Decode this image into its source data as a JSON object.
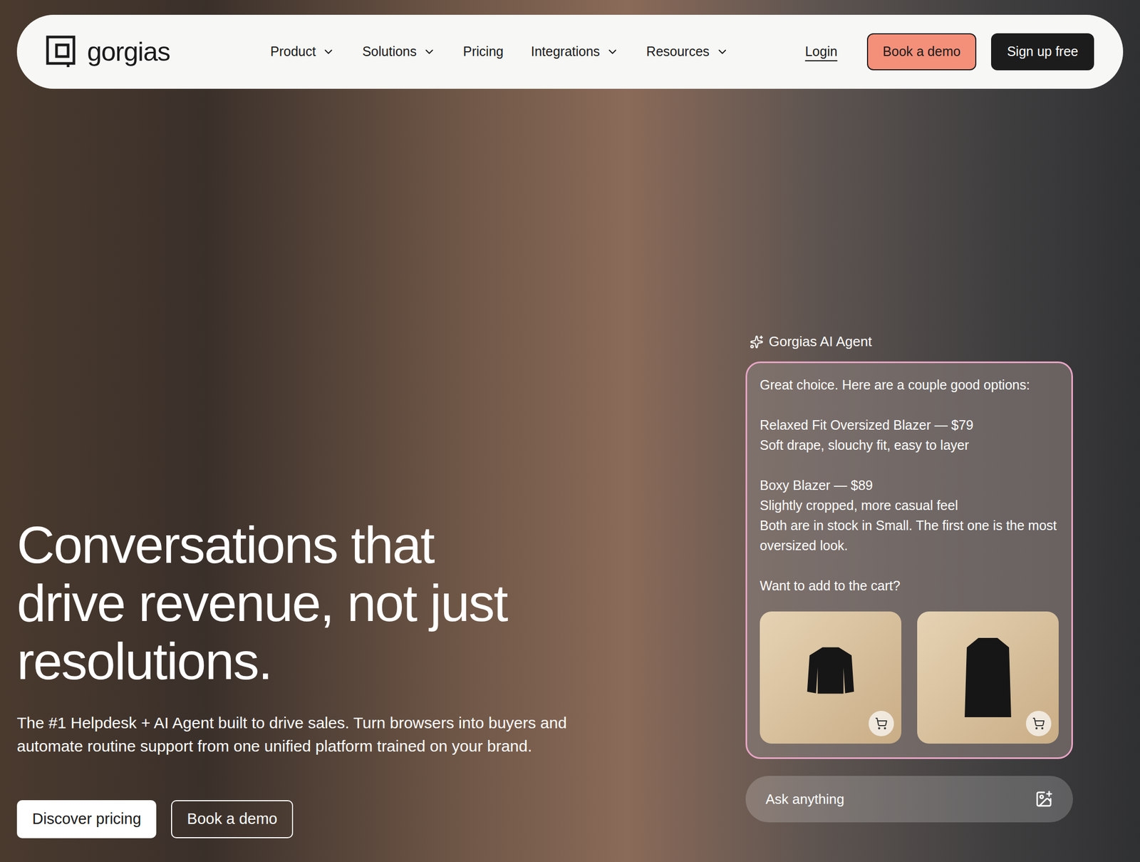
{
  "nav": {
    "logo": "gorgias",
    "links": [
      {
        "label": "Product",
        "has_menu": true
      },
      {
        "label": "Solutions",
        "has_menu": true
      },
      {
        "label": "Pricing",
        "has_menu": false
      },
      {
        "label": "Integrations",
        "has_menu": true
      },
      {
        "label": "Resources",
        "has_menu": true
      }
    ],
    "login": "Login",
    "demo_button": "Book a demo",
    "signup_button": "Sign up free"
  },
  "hero": {
    "heading": "Conversations that drive revenue, not just resolutions.",
    "subtext": "The #1 Helpdesk + AI Agent built to drive sales. Turn browsers into buyers and automate routine support from one unified platform trained on your brand.",
    "buttons": [
      {
        "label": "Discover pricing",
        "kind": "solid"
      },
      {
        "label": "Book a demo",
        "kind": "outline"
      }
    ]
  },
  "chat": {
    "agent_label": "Gorgias AI Agent",
    "intro": "Great choice. Here are a couple good options:",
    "products": [
      {
        "title": "Relaxed Fit Oversized Blazer — $79",
        "description": "Soft drape, slouchy fit, easy to layer"
      },
      {
        "title": "Boxy Blazer — $89",
        "description": "Slightly cropped, more casual feel"
      }
    ],
    "note": "Both are in stock in Small. The first one is the most oversized look.",
    "question": "Want to add to the cart?",
    "input_placeholder": "Ask anything"
  }
}
